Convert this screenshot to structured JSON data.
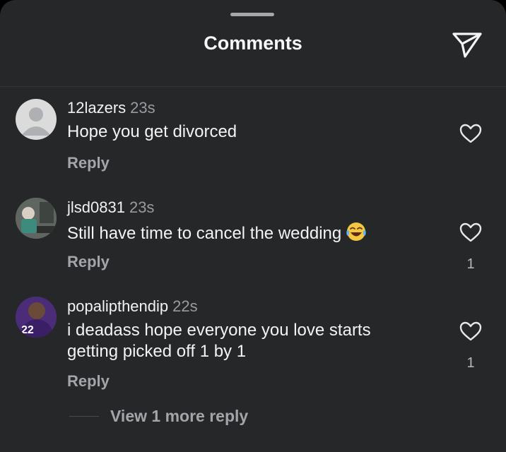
{
  "header": {
    "title": "Comments",
    "share_icon": "send-paper-plane-icon"
  },
  "comments": [
    {
      "username": "12lazers",
      "time": "23s",
      "text": "Hope you get divorced",
      "reply_label": "Reply",
      "likes": ""
    },
    {
      "username": "jlsd0831",
      "time": "23s",
      "text": "Still have time to cancel the wedding",
      "emoji": "😂",
      "reply_label": "Reply",
      "likes": "1"
    },
    {
      "username": "popalipthendip",
      "time": "22s",
      "text": "i deadass hope everyone you love starts getting picked off 1 by 1",
      "reply_label": "Reply",
      "likes": "1"
    }
  ],
  "view_more_label": "View 1 more reply",
  "colors": {
    "background": "#262729",
    "muted": "#a4a5aa",
    "text": "#f3f3f3"
  }
}
